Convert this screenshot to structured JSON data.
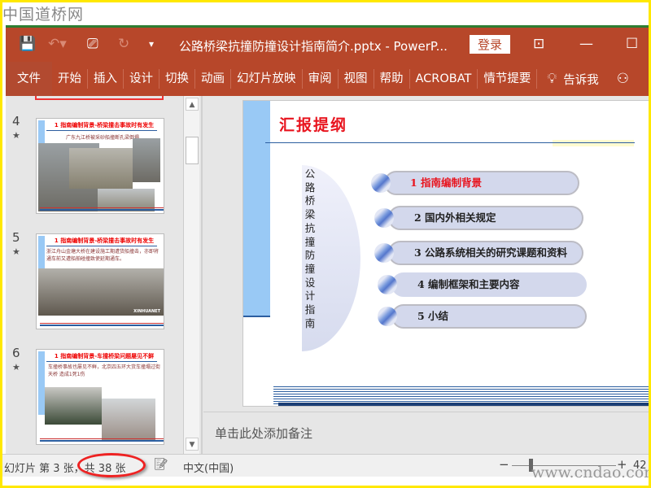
{
  "watermark_top": "中国道桥网",
  "watermark_bottom": "www.cndao.com",
  "titlebar": {
    "title": "公路桥梁抗撞防撞设计指南简介.pptx  -  PowerP...",
    "login": "登录",
    "icons": [
      "save-icon",
      "undo-icon",
      "presentation-icon",
      "redo-icon",
      "customize-icon",
      "ribbon-display-icon",
      "minimize-icon",
      "maximize-icon"
    ]
  },
  "ribbon": {
    "tabs": [
      "文件",
      "开始",
      "插入",
      "设计",
      "切换",
      "动画",
      "幻灯片放映",
      "审阅",
      "视图",
      "帮助",
      "ACROBAT",
      "情节提要"
    ],
    "tell_me": "告诉我"
  },
  "thumbnails": [
    {
      "num": "4",
      "title": "1 指南编制背景-桥梁撞击事故时有发生",
      "text": "广东九江桥被采砂船撞断孔梁倒塌"
    },
    {
      "num": "5",
      "title": "1 指南编制背景-桥梁撞击事故时有发生",
      "text": "浙江舟山金塘大桥在建设施工期遭货船撞击，亦即将通车前又遭船舶碰撞致使延期通车。",
      "caption": "XINHUANET"
    },
    {
      "num": "6",
      "title": "1 指南编制背景-车撞桥梁问题屡见不鲜",
      "text": "车撞桥事故也屡见不鲜，北京四五环大货车撞塌过街天桥 造成1死1伤"
    }
  ],
  "slide": {
    "title": "汇报提纲",
    "side_title": "公路桥梁抗撞防撞设计指南",
    "items": [
      "1  指南编制背景",
      "2  国内外相关规定",
      "3  公路系统相关的研究课题和资料",
      "4  编制框架和主要内容",
      "5  小结"
    ],
    "active_index": 0
  },
  "notes_placeholder": "单击此处添加备注",
  "status": {
    "slide_info": "幻灯片 第 3 张，共 38 张",
    "language": "中文(中国)",
    "zoom": "42"
  },
  "colors": {
    "accent": "#b7472a",
    "title_red": "#e8141e",
    "slide_blue": "#99c9f5"
  }
}
